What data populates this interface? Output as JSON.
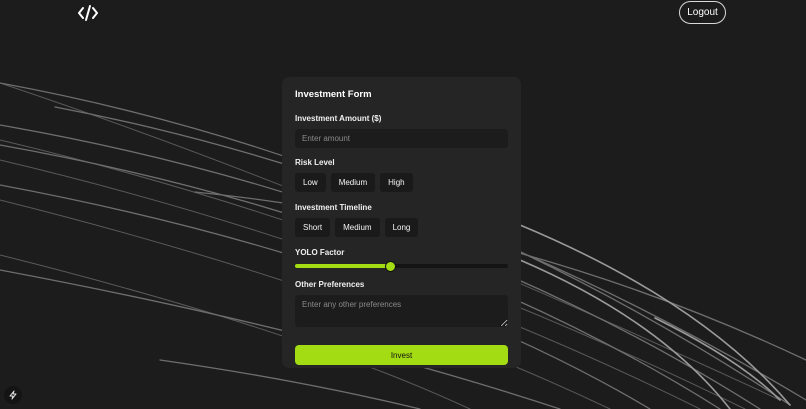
{
  "header": {
    "logo_icon": "code-brackets-icon",
    "logout_label": "Logout"
  },
  "form": {
    "title": "Investment Form",
    "amount": {
      "label": "Investment Amount ($)",
      "placeholder": "Enter amount",
      "value": ""
    },
    "risk": {
      "label": "Risk Level",
      "options": [
        "Low",
        "Medium",
        "High"
      ]
    },
    "timeline": {
      "label": "Investment Timeline",
      "options": [
        "Short",
        "Medium",
        "Long"
      ]
    },
    "yolo": {
      "label": "YOLO Factor",
      "value_percent": 45
    },
    "preferences": {
      "label": "Other Preferences",
      "placeholder": "Enter any other preferences"
    },
    "submit_label": "Invest"
  },
  "colors": {
    "background": "#1c1c1c",
    "card": "#252525",
    "accent": "#a4dc14"
  },
  "corner_icon": "bolt-icon"
}
